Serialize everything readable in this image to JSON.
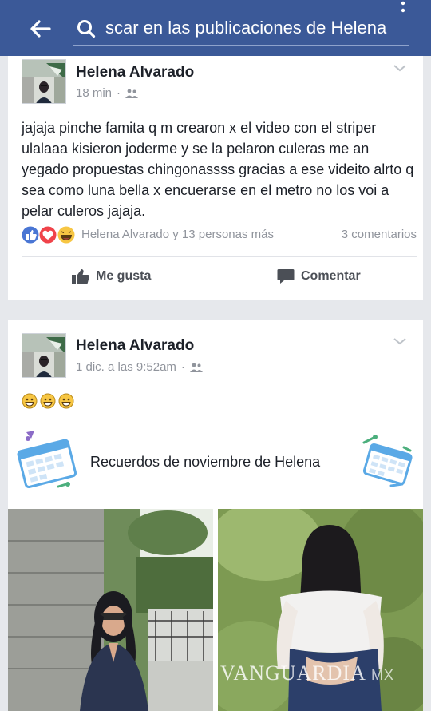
{
  "colors": {
    "header": "#3b5998",
    "like_blue": "#4a76d4",
    "love_red": "#f0434a",
    "haha_yellow": "#f7c643"
  },
  "topbar": {
    "search_text": "scar en las publicaciones de Helena",
    "back_icon": "arrow-left-icon",
    "search_icon": "search-icon"
  },
  "posts": [
    {
      "author": "Helena Alvarado",
      "time": "18 min",
      "separator": "·",
      "privacy_icon": "friends-icon",
      "text": "jajaja pinche famita q m crearon x el video con el striper ulalaaa kisieron joderme y se la pelaron culeras me an yegado propuestas chingonassss gracias a ese videito alrto q sea como luna bella x encuerarse en el metro no los voi a pelar culeros jajaja.",
      "reactions_text": "Helena Alvarado y 13 personas más",
      "comments_text": "3 comentarios",
      "like_label": "Me gusta",
      "comment_label": "Comentar"
    },
    {
      "author": "Helena Alvarado",
      "time": "1 dic. a las 9:52am",
      "separator": "·",
      "privacy_icon": "friends-icon",
      "emoji_count": 3,
      "memories_title": "Recuerdos de noviembre de Helena"
    }
  ],
  "watermark": {
    "text": "VANGUARDIA",
    "suffix": "MX"
  }
}
